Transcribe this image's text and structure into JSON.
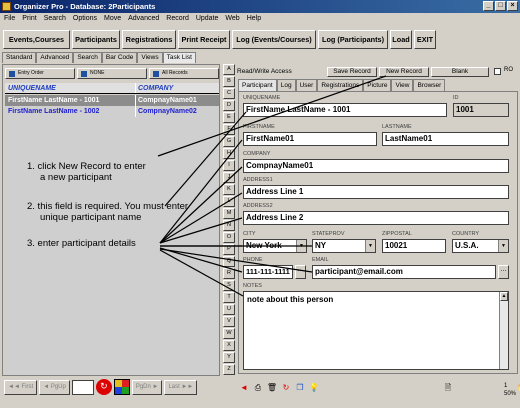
{
  "window": {
    "title": "Organizer Pro - Database: 2Participants",
    "buttons": [
      "_",
      "□",
      "×"
    ]
  },
  "menu": [
    "File",
    "Print",
    "Search",
    "Options",
    "Move",
    "Advanced",
    "Record",
    "Update",
    "Web",
    "Help"
  ],
  "toolbar": {
    "events_courses": "Events,Courses",
    "participants": "Participants",
    "registrations": "Registrations",
    "print_receipt": "Print Receipt",
    "log_events": "Log (Events/Courses)",
    "log_participants": "Log (Participants)",
    "load": "Load",
    "exit": "EXIT"
  },
  "left_tabs": [
    "Standard",
    "Advanced",
    "Search",
    "Bar Code",
    "Views",
    "Task List"
  ],
  "list": {
    "tool_entry": "Entry Order",
    "tool_none": "NONE",
    "tool_all": "All Records",
    "col1": "UNIQUENAME",
    "col2": "COMPANY",
    "rows": [
      {
        "name": "FirstName LastName - 1001",
        "company": "CompnayName01"
      },
      {
        "name": "FirstName LastName - 1002",
        "company": "CompnayName02"
      }
    ]
  },
  "nav": {
    "first": "First",
    "pgup": "PgUp",
    "pgdn": "PgDn",
    "last": "Last"
  },
  "alpha": [
    "A",
    "B",
    "C",
    "D",
    "E",
    "F",
    "G",
    "H",
    "I",
    "J",
    "K",
    "L",
    "M",
    "N",
    "O",
    "P",
    "Q",
    "R",
    "S",
    "T",
    "U",
    "V",
    "W",
    "X",
    "Y",
    "Z"
  ],
  "record_bar": {
    "mode": "Read/Write Access",
    "save": "Save Record",
    "new": "New Record",
    "blank": "Blank",
    "ro": "RO"
  },
  "right_tabs": [
    "Participant",
    "Log",
    "User",
    "Registrations",
    "Picture",
    "View",
    "Browser"
  ],
  "form": {
    "uniquename_label": "UNIQUENAME",
    "uniquename": "FirstName LastName - 1001",
    "id_label": "ID",
    "id": "1001",
    "firstname_label": "FIRSTNAME",
    "firstname": "FirstName01",
    "lastname_label": "LASTNAME",
    "lastname": "LastName01",
    "company_label": "COMPANY",
    "company": "CompnayName01",
    "address1_label": "ADDRESS1",
    "address1": "Address Line 1",
    "address2_label": "ADDRESS2",
    "address2": "Address Line 2",
    "city_label": "CITY",
    "city": "New York",
    "state_label": "STATEPROV",
    "state": "NY",
    "zip_label": "ZIPPOSTAL",
    "zip": "10021",
    "country_label": "COUNTRY",
    "country": "U.S.A.",
    "phone_label": "PHONE",
    "phone": "111-111-1111",
    "email_label": "EMAIL",
    "email": "participant@email.com",
    "notes_label": "NOTES",
    "notes": "note about this person"
  },
  "annotations": {
    "a1_line1": "1. click New Record to enter",
    "a1_line2": "a new participant",
    "a2_line1": "2. this field is required. You must enter",
    "a2_line2": "unique participant name",
    "a3": "3. enter participant details"
  },
  "status": {
    "count": "1",
    "zoom": "50%"
  }
}
